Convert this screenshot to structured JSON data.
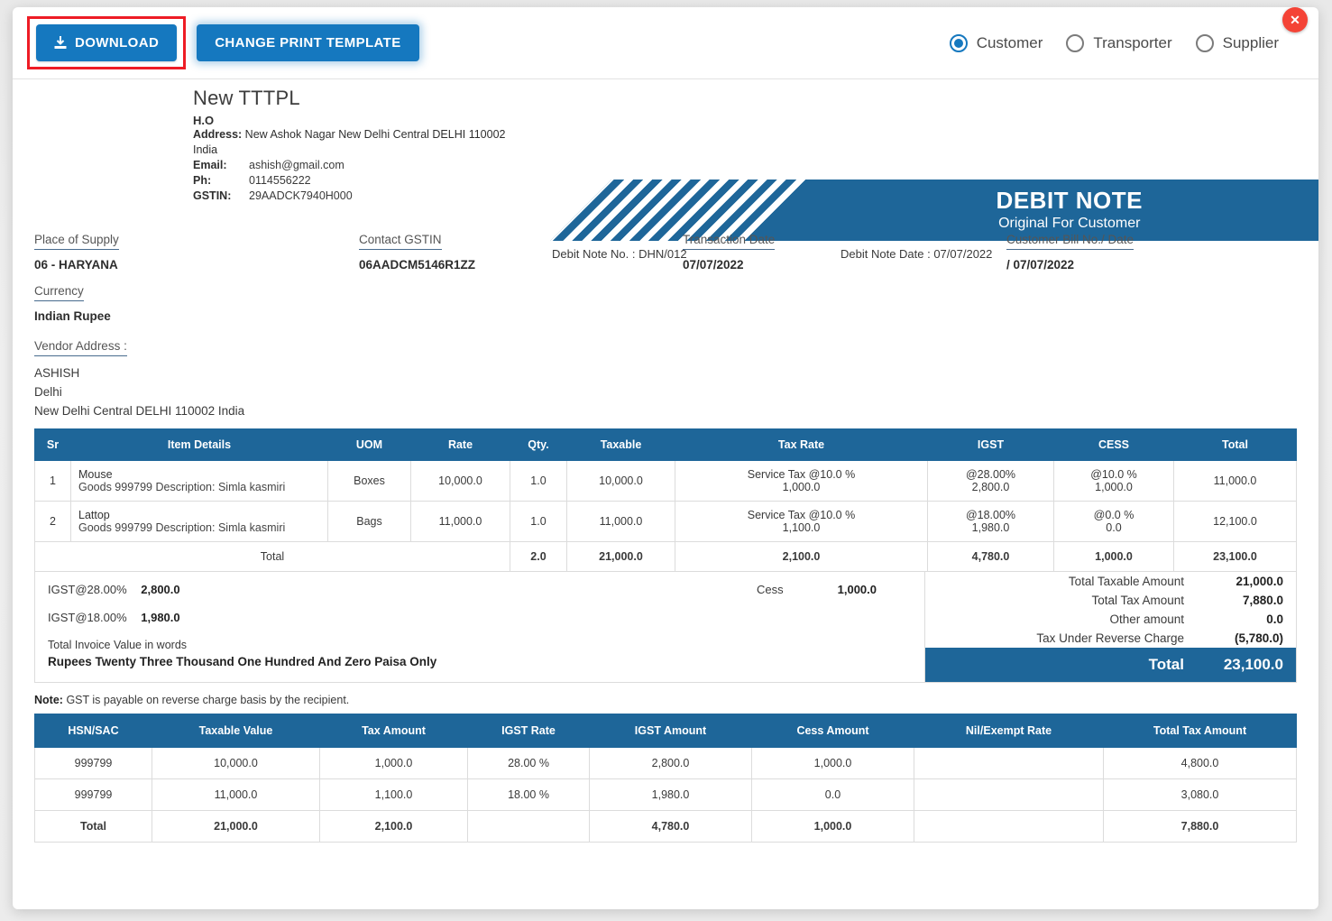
{
  "toolbar": {
    "download_label": "DOWNLOAD",
    "download_icon": "download-icon",
    "change_template_label": "CHANGE PRINT TEMPLATE",
    "close_icon": "close-icon",
    "close_glyph": "✕",
    "accent_color": "#1578bf",
    "highlight_color": "#ee1c25",
    "radios": [
      {
        "label": "Customer",
        "checked": true
      },
      {
        "label": "Transporter",
        "checked": false
      },
      {
        "label": "Supplier",
        "checked": false
      }
    ]
  },
  "document": {
    "brand_color": "#1e6699",
    "company": {
      "name": "New TTTPL",
      "branch": "H.O",
      "address_label": "Address:",
      "address": "New Ashok Nagar New Delhi Central DELHI 110002",
      "country": "India",
      "email_label": "Email:",
      "email": "ashish@gmail.com",
      "phone_label": "Ph:",
      "phone": "0114556222",
      "gstin_label": "GSTIN:",
      "gstin": "29AADCK7940H000"
    },
    "banner": {
      "title": "DEBIT NOTE",
      "subtitle": "Original For Customer"
    },
    "note_no": "Debit Note No. : DHN/012",
    "note_date": "Debit Note Date : 07/07/2022",
    "meta": {
      "place_of_supply_label": "Place of Supply",
      "place_of_supply": "06 - HARYANA",
      "currency_label": "Currency",
      "currency": "Indian Rupee",
      "vendor_address_label": "Vendor Address :",
      "vendor_address": [
        "ASHISH",
        "Delhi",
        "New Delhi Central DELHI 110002 India"
      ],
      "contact_gstin_label": "Contact GSTIN",
      "contact_gstin": "06AADCM5146R1ZZ",
      "transaction_date_label": "Transaction Date",
      "transaction_date": "07/07/2022",
      "customer_bill_label": "Customer Bill No./ Date",
      "customer_bill": "/ 07/07/2022"
    },
    "items_table": {
      "headers": [
        "Sr",
        "Item Details",
        "UOM",
        "Rate",
        "Qty.",
        "Taxable",
        "Tax Rate",
        "IGST",
        "CESS",
        "Total"
      ],
      "rows": [
        {
          "sr": "1",
          "item_name": "Mouse",
          "item_desc": "Goods 999799 Description: Simla kasmiri",
          "uom": "Boxes",
          "rate": "10,000.0",
          "qty": "1.0",
          "taxable": "10,000.0",
          "tax_rate_1": "Service Tax @10.0 %",
          "tax_rate_2": "1,000.0",
          "igst_1": "@28.00%",
          "igst_2": "2,800.0",
          "cess_1": "@10.0 %",
          "cess_2": "1,000.0",
          "total": "11,000.0"
        },
        {
          "sr": "2",
          "item_name": "Lattop",
          "item_desc": "Goods 999799 Description: Simla kasmiri",
          "uom": "Bags",
          "rate": "11,000.0",
          "qty": "1.0",
          "taxable": "11,000.0",
          "tax_rate_1": "Service Tax @10.0 %",
          "tax_rate_2": "1,100.0",
          "igst_1": "@18.00%",
          "igst_2": "1,980.0",
          "cess_1": "@0.0 %",
          "cess_2": "0.0",
          "total": "12,100.0"
        }
      ],
      "total_row": {
        "label": "Total",
        "qty": "2.0",
        "taxable": "21,000.0",
        "tax_rate": "2,100.0",
        "igst": "4,780.0",
        "cess": "1,000.0",
        "total": "23,100.0"
      }
    },
    "summary": {
      "igst_28_label": "IGST@28.00%",
      "igst_28_value": "2,800.0",
      "igst_18_label": "IGST@18.00%",
      "igst_18_value": "1,980.0",
      "cess_label": "Cess",
      "cess_value": "1,000.0",
      "words_label": "Total Invoice Value in words",
      "words_value": "Rupees Twenty Three Thousand One Hundred And Zero Paisa Only",
      "totals": [
        {
          "label": "Total Taxable Amount",
          "value": "21,000.0"
        },
        {
          "label": "Total Tax Amount",
          "value": "7,880.0"
        },
        {
          "label": "Other amount",
          "value": "0.0"
        },
        {
          "label": "Tax Under Reverse Charge",
          "value": "(5,780.0)"
        }
      ],
      "grand_label": "Total",
      "grand_value": "23,100.0"
    },
    "note_prefix": "Note:",
    "note_text": "GST is payable on reverse charge basis by the recipient.",
    "hsn_table": {
      "headers": [
        "HSN/SAC",
        "Taxable Value",
        "Tax Amount",
        "IGST Rate",
        "IGST Amount",
        "Cess Amount",
        "Nil/Exempt Rate",
        "Total Tax Amount"
      ],
      "rows": [
        {
          "hsn": "999799",
          "taxable": "10,000.0",
          "tax": "1,000.0",
          "igst_rate": "28.00 %",
          "igst_amt": "2,800.0",
          "cess": "1,000.0",
          "nil": "",
          "total_tax": "4,800.0"
        },
        {
          "hsn": "999799",
          "taxable": "11,000.0",
          "tax": "1,100.0",
          "igst_rate": "18.00 %",
          "igst_amt": "1,980.0",
          "cess": "0.0",
          "nil": "",
          "total_tax": "3,080.0"
        }
      ],
      "total_row": {
        "hsn": "Total",
        "taxable": "21,000.0",
        "tax": "2,100.0",
        "igst_rate": "",
        "igst_amt": "4,780.0",
        "cess": "1,000.0",
        "nil": "",
        "total_tax": "7,880.0"
      }
    }
  }
}
